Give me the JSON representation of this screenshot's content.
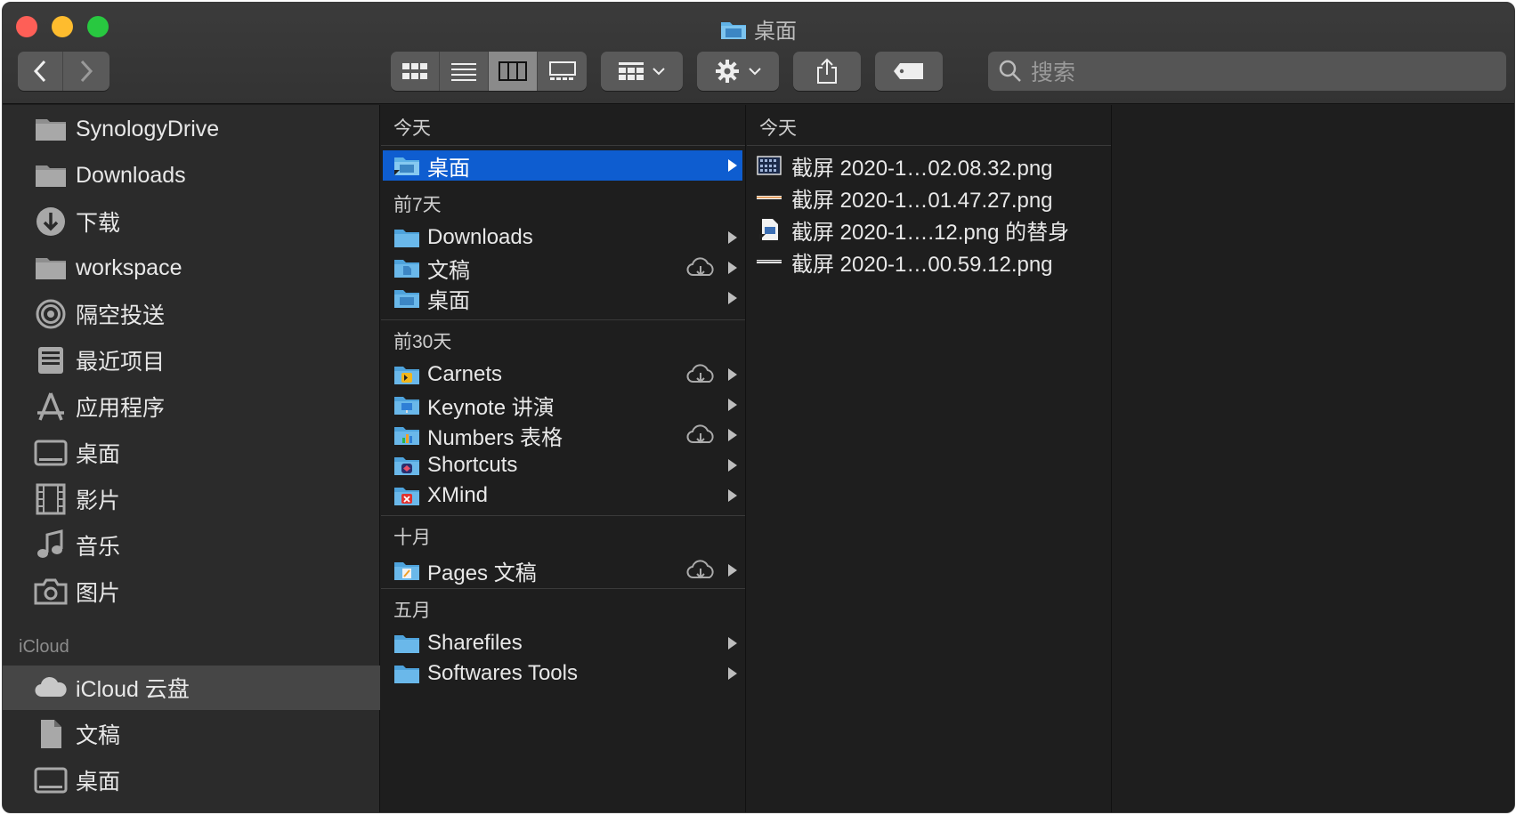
{
  "window": {
    "title": "桌面"
  },
  "search": {
    "placeholder": "搜索"
  },
  "sidebar": {
    "favorites": [
      {
        "label": "SynologyDrive",
        "icon": "folder-icon"
      },
      {
        "label": "Downloads",
        "icon": "folder-icon"
      },
      {
        "label": "下载",
        "icon": "download-icon"
      },
      {
        "label": "workspace",
        "icon": "folder-icon"
      },
      {
        "label": "隔空投送",
        "icon": "airdrop-icon"
      },
      {
        "label": "最近项目",
        "icon": "recents-icon"
      },
      {
        "label": "应用程序",
        "icon": "applications-icon"
      },
      {
        "label": "桌面",
        "icon": "desktop-icon"
      },
      {
        "label": "影片",
        "icon": "movies-icon"
      },
      {
        "label": "音乐",
        "icon": "music-icon"
      },
      {
        "label": "图片",
        "icon": "camera-icon"
      }
    ],
    "icloud_header": "iCloud",
    "icloud": [
      {
        "label": "iCloud 云盘",
        "icon": "cloud-icon"
      },
      {
        "label": "文稿",
        "icon": "document-icon"
      },
      {
        "label": "桌面",
        "icon": "desktop-icon"
      }
    ]
  },
  "column1": {
    "groups": [
      {
        "header": "今天",
        "items": [
          {
            "label": "桌面",
            "cloud": false,
            "selected": true
          }
        ]
      },
      {
        "header": "前7天",
        "items": [
          {
            "label": "Downloads",
            "cloud": false
          },
          {
            "label": "文稿",
            "cloud": true
          },
          {
            "label": "桌面",
            "cloud": false
          }
        ]
      },
      {
        "header": "前30天",
        "items": [
          {
            "label": "Carnets",
            "cloud": true
          },
          {
            "label": "Keynote 讲演",
            "cloud": false
          },
          {
            "label": "Numbers 表格",
            "cloud": true
          },
          {
            "label": "Shortcuts",
            "cloud": false
          },
          {
            "label": "XMind",
            "cloud": false
          }
        ]
      },
      {
        "header": "十月",
        "items": [
          {
            "label": "Pages 文稿",
            "cloud": true
          }
        ]
      },
      {
        "header": "五月",
        "items": [
          {
            "label": "Sharefiles",
            "cloud": false
          },
          {
            "label": "Softwares Tools",
            "cloud": false
          }
        ]
      }
    ]
  },
  "column2": {
    "header": "今天",
    "files": [
      {
        "label": "截屏 2020-1…02.08.32.png"
      },
      {
        "label": "截屏 2020-1…01.47.27.png"
      },
      {
        "label": "截屏 2020-1….12.png 的替身"
      },
      {
        "label": "截屏 2020-1…00.59.12.png"
      }
    ]
  }
}
